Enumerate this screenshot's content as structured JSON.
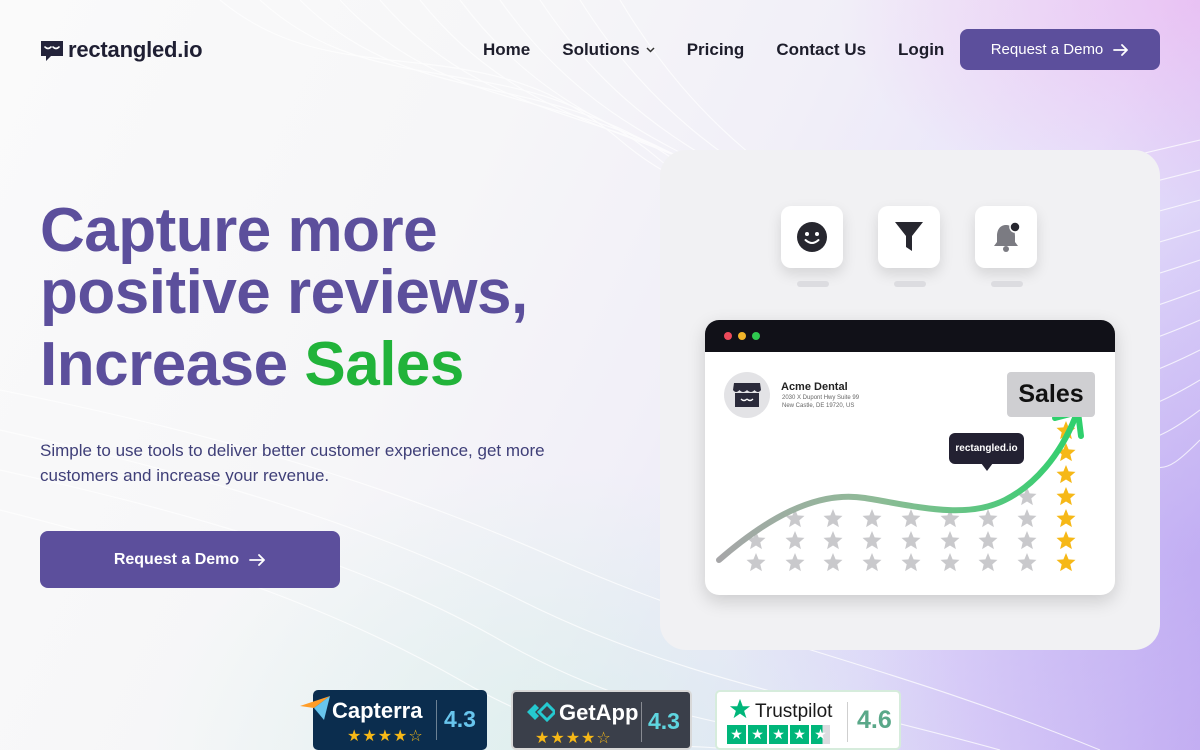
{
  "brand": {
    "name": "rectangled.io"
  },
  "nav": {
    "items": [
      {
        "label": "Home"
      },
      {
        "label": "Solutions",
        "has_dropdown": true
      },
      {
        "label": "Pricing"
      },
      {
        "label": "Contact Us"
      },
      {
        "label": "Login"
      }
    ],
    "cta_label": "Request a Demo"
  },
  "hero": {
    "title_line1": "Capture more",
    "title_line2": "positive reviews,",
    "title_line3_prefix": "Increase",
    "title_line3_highlight": "Sales",
    "subtitle": "Simple to use tools to deliver better customer experience, get more customers and increase your revenue.",
    "cta_label": "Request a Demo"
  },
  "illustration": {
    "icons": [
      "smiley-icon",
      "filter-icon",
      "bell-icon"
    ],
    "business_name": "Acme Dental",
    "address_line1": "2030 X Dupont Hwy Suite 99",
    "address_line2": "New Castle, DE 19720, US",
    "badge_label": "Sales",
    "tooltip_label": "rectangled.io"
  },
  "ratings": [
    {
      "platform": "Capterra",
      "score": "4.3",
      "stars": 4.3
    },
    {
      "platform": "GetApp",
      "score": "4.3",
      "stars": 4.3
    },
    {
      "platform": "Trustpilot",
      "score": "4.6",
      "stars": 4.6
    }
  ],
  "colors": {
    "primary": "#5c4f9c",
    "accent_green": "#21b33a",
    "star_gold": "#f6b817",
    "star_gray": "#c9c9cc",
    "trust_green": "#00b67a"
  }
}
